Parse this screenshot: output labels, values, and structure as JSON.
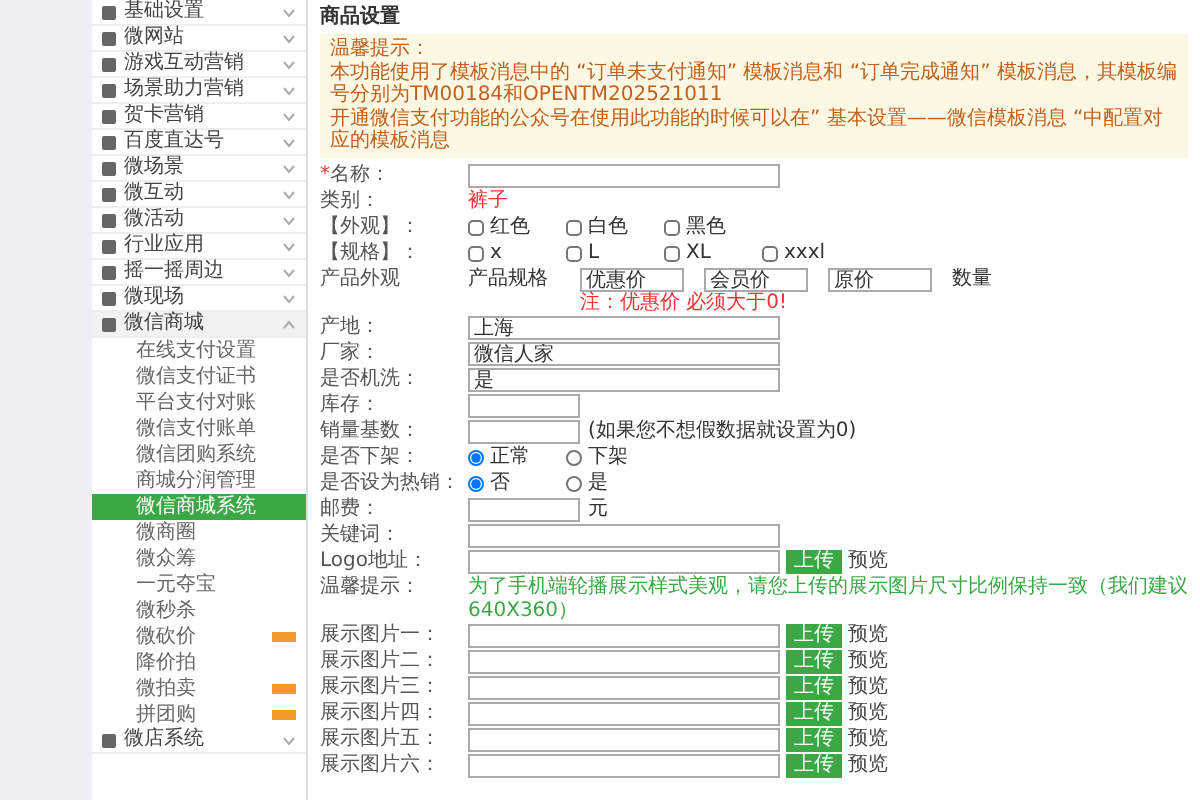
{
  "sidebar": {
    "items": [
      {
        "label": "基础设置",
        "expanded": false
      },
      {
        "label": "微网站",
        "expanded": false
      },
      {
        "label": "游戏互动营销",
        "expanded": false
      },
      {
        "label": "场景助力营销",
        "expanded": false
      },
      {
        "label": "贺卡营销",
        "expanded": false
      },
      {
        "label": "百度直达号",
        "expanded": false
      },
      {
        "label": "微场景",
        "expanded": false
      },
      {
        "label": "微互动",
        "expanded": false
      },
      {
        "label": "微活动",
        "expanded": false
      },
      {
        "label": "行业应用",
        "expanded": false
      },
      {
        "label": "摇一摇周边",
        "expanded": false
      },
      {
        "label": "微现场",
        "expanded": false
      },
      {
        "label": "微信商城",
        "expanded": true,
        "children": [
          {
            "label": "在线支付设置",
            "selected": false,
            "badge": false
          },
          {
            "label": "微信支付证书",
            "selected": false,
            "badge": false
          },
          {
            "label": "平台支付对账",
            "selected": false,
            "badge": false
          },
          {
            "label": "微信支付账单",
            "selected": false,
            "badge": false
          },
          {
            "label": "微信团购系统",
            "selected": false,
            "badge": false
          },
          {
            "label": "商城分润管理",
            "selected": false,
            "badge": false
          },
          {
            "label": "微信商城系统",
            "selected": true,
            "badge": false
          },
          {
            "label": "微商圈",
            "selected": false,
            "badge": false
          },
          {
            "label": "微众筹",
            "selected": false,
            "badge": false
          },
          {
            "label": "一元夺宝",
            "selected": false,
            "badge": false
          },
          {
            "label": "微秒杀",
            "selected": false,
            "badge": false
          },
          {
            "label": "微砍价",
            "selected": false,
            "badge": true
          },
          {
            "label": "降价拍",
            "selected": false,
            "badge": false
          },
          {
            "label": "微拍卖",
            "selected": false,
            "badge": true
          },
          {
            "label": "拼团购",
            "selected": false,
            "badge": true
          }
        ]
      },
      {
        "label": "微店系统",
        "expanded": false
      }
    ]
  },
  "main": {
    "title": "商品设置",
    "notice": {
      "heading": "温馨提示：",
      "lines": [
        "本功能使用了模板消息中的 “订单未支付通知” 模板消息和 “订单完成通知” 模板消息，其模板编号分别为TM00184和OPENTM202521011",
        "开通微信支付功能的公众号在使用此功能的时候可以在” 基本设置——微信模板消息 “中配置对应的模板消息"
      ]
    },
    "form": {
      "rows": [
        {
          "kind": "text",
          "required_mark": "*",
          "label": "名称：",
          "value": ""
        },
        {
          "kind": "static",
          "label": "类别：",
          "value": "裤子"
        },
        {
          "kind": "checkboxes",
          "label": "【外观】：",
          "options": [
            {
              "label": "红色",
              "checked": false
            },
            {
              "label": "白色",
              "checked": false
            },
            {
              "label": "黑色",
              "checked": false
            }
          ]
        },
        {
          "kind": "checkboxes",
          "label": "【规格】：",
          "options": [
            {
              "label": "x",
              "checked": false
            },
            {
              "label": "L",
              "checked": false
            },
            {
              "label": "XL",
              "checked": false
            },
            {
              "label": "xxxl",
              "checked": false
            }
          ]
        },
        {
          "kind": "price",
          "label": "产品外观",
          "sublabel": "产品规格",
          "fields": [
            {
              "value": "优惠价"
            },
            {
              "value": "会员价"
            },
            {
              "value": "原价"
            }
          ],
          "suffix": "数量",
          "note": "注：优惠价 必须大于0!"
        },
        {
          "kind": "text",
          "label": "产地：",
          "value": "上海"
        },
        {
          "kind": "text",
          "label": "厂家：",
          "value": "微信人家"
        },
        {
          "kind": "text",
          "label": "是否机洗：",
          "value": "是"
        },
        {
          "kind": "short",
          "label": "库存：",
          "value": ""
        },
        {
          "kind": "short",
          "label": "销量基数：",
          "value": "",
          "after": "(如果您不想假数据就设置为0)"
        },
        {
          "kind": "radios",
          "label": "是否下架：",
          "options": [
            {
              "label": "正常",
              "selected": true
            },
            {
              "label": "下架",
              "selected": false
            }
          ]
        },
        {
          "kind": "radios",
          "label": "是否设为热销：",
          "options": [
            {
              "label": "否",
              "selected": true
            },
            {
              "label": "是",
              "selected": false
            }
          ]
        },
        {
          "kind": "short",
          "label": "邮费：",
          "value": "",
          "after": "元"
        },
        {
          "kind": "text",
          "label": "关键词：",
          "value": ""
        },
        {
          "kind": "upload",
          "label": "Logo地址：",
          "value": "",
          "button": "上传",
          "link": "预览"
        },
        {
          "kind": "hint",
          "label": "温馨提示：",
          "value": "为了手机端轮播展示样式美观，请您上传的展示图片尺寸比例保持一致（我们建议640X360）"
        },
        {
          "kind": "upload",
          "label": "展示图片一：",
          "value": "",
          "button": "上传",
          "link": "预览"
        },
        {
          "kind": "upload",
          "label": "展示图片二：",
          "value": "",
          "button": "上传",
          "link": "预览"
        },
        {
          "kind": "upload",
          "label": "展示图片三：",
          "value": "",
          "button": "上传",
          "link": "预览"
        },
        {
          "kind": "upload",
          "label": "展示图片四：",
          "value": "",
          "button": "上传",
          "link": "预览"
        },
        {
          "kind": "upload",
          "label": "展示图片五：",
          "value": "",
          "button": "上传",
          "link": "预览"
        },
        {
          "kind": "upload",
          "label": "展示图片六：",
          "value": "",
          "button": "上传",
          "link": "预览"
        }
      ]
    }
  }
}
